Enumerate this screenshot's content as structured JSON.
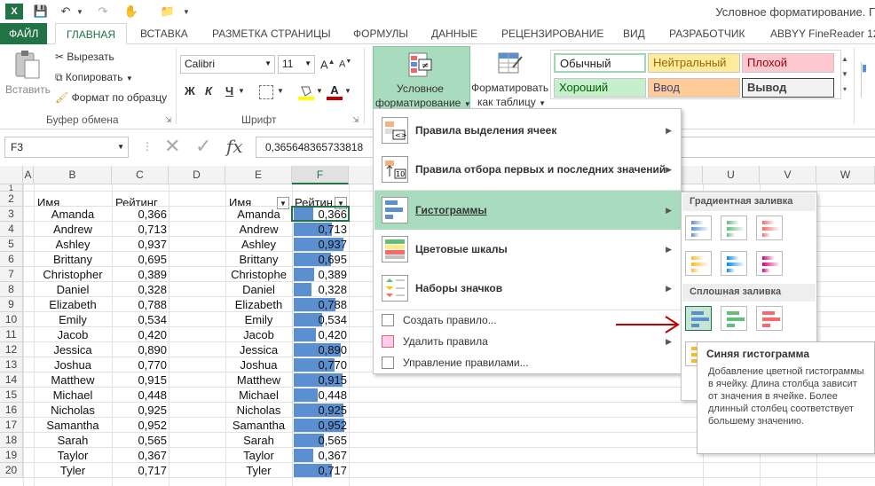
{
  "window": {
    "title": "Условное форматирование. Г"
  },
  "tabs": [
    "ФАЙЛ",
    "ГЛАВНАЯ",
    "ВСТАВКА",
    "РАЗМЕТКА СТРАНИЦЫ",
    "ФОРМУЛЫ",
    "ДАННЫЕ",
    "РЕЦЕНЗИРОВАНИЕ",
    "ВИД",
    "РАЗРАБОТЧИК",
    "ABBYY FineReader 12"
  ],
  "clipboard": {
    "paste": "Вставить",
    "cut": "Вырезать",
    "copy": "Копировать",
    "format_painter": "Формат по образцу",
    "group": "Буфер обмена"
  },
  "font": {
    "name": "Calibri",
    "size": "11",
    "bold": "Ж",
    "italic": "К",
    "underline": "Ч",
    "group": "Шрифт",
    "grow": "A",
    "shrink": "A"
  },
  "cf_button": {
    "line1": "Условное",
    "line2": "форматирование"
  },
  "format_table": {
    "line1": "Форматировать",
    "line2": "как таблицу"
  },
  "styles": {
    "normal": "Обычный",
    "neutral": "Нейтральный",
    "bad": "Плохой",
    "good": "Хороший",
    "input": "Ввод",
    "output": "Вывод"
  },
  "formula_bar": {
    "name_box": "F3",
    "fx": "fx",
    "value": "0,365648365733818"
  },
  "columns": [
    "A",
    "B",
    "C",
    "D",
    "E",
    "F",
    "U",
    "V",
    "W"
  ],
  "rows": [
    "1",
    "2",
    "3",
    "4",
    "5",
    "6",
    "7",
    "8",
    "9",
    "10",
    "11",
    "12",
    "13",
    "14",
    "15",
    "16",
    "17",
    "18",
    "19",
    "20"
  ],
  "headers": {
    "b2": "Имя",
    "c2": "Рейтинг",
    "e2": "Имя",
    "f2": "Рейтин"
  },
  "table": [
    {
      "name": "Amanda",
      "rating": "0,366"
    },
    {
      "name": "Andrew",
      "rating": "0,713"
    },
    {
      "name": "Ashley",
      "rating": "0,937"
    },
    {
      "name": "Brittany",
      "rating": "0,695"
    },
    {
      "name": "Christopher",
      "rating": "0,389"
    },
    {
      "name": "Daniel",
      "rating": "0,328"
    },
    {
      "name": "Elizabeth",
      "rating": "0,788"
    },
    {
      "name": "Emily",
      "rating": "0,534"
    },
    {
      "name": "Jacob",
      "rating": "0,420"
    },
    {
      "name": "Jessica",
      "rating": "0,890"
    },
    {
      "name": "Joshua",
      "rating": "0,770"
    },
    {
      "name": "Matthew",
      "rating": "0,915"
    },
    {
      "name": "Michael",
      "rating": "0,448"
    },
    {
      "name": "Nicholas",
      "rating": "0,925"
    },
    {
      "name": "Samantha",
      "rating": "0,952"
    },
    {
      "name": "Sarah",
      "rating": "0,565"
    },
    {
      "name": "Taylor",
      "rating": "0,367"
    },
    {
      "name": "Tyler",
      "rating": "0,717"
    }
  ],
  "table_e_names": [
    "Amanda",
    "Andrew",
    "Ashley",
    "Brittany",
    "Christophe",
    "Daniel",
    "Elizabeth",
    "Emily",
    "Jacob",
    "Jessica",
    "Joshua",
    "Matthew",
    "Michael",
    "Nicholas",
    "Samantha",
    "Sarah",
    "Taylor",
    "Tyler"
  ],
  "databar_values": [
    0.366,
    0.713,
    0.937,
    0.695,
    0.389,
    0.328,
    0.788,
    0.534,
    0.42,
    0.89,
    0.77,
    0.915,
    0.448,
    0.925,
    0.952,
    0.565,
    0.367,
    0.717
  ],
  "menu": {
    "highlight_rules": "Правила выделения ячеек",
    "top_bottom_rules": "Правила отбора первых и последних значений",
    "data_bars": "Гистограммы",
    "color_scales": "Цветовые шкалы",
    "icon_sets": "Наборы значков",
    "new_rule": "Создать правило...",
    "clear_rules": "Удалить правила",
    "manage_rules": "Управление правилами..."
  },
  "submenu": {
    "gradient": "Градиентная заливка",
    "solid": "Сплошная заливка"
  },
  "tooltip": {
    "title": "Синяя гистограмма",
    "body": "Добавление цветной гистограммы в ячейку. Длина столбца зависит от значения в ячейке. Более длинный столбец соответствует большему значению."
  },
  "colors": {
    "excel_green": "#217346",
    "bar_blue": "#5b8fcf",
    "menu_highlight": "#a9dcbf",
    "arrow_red": "#c00000"
  }
}
